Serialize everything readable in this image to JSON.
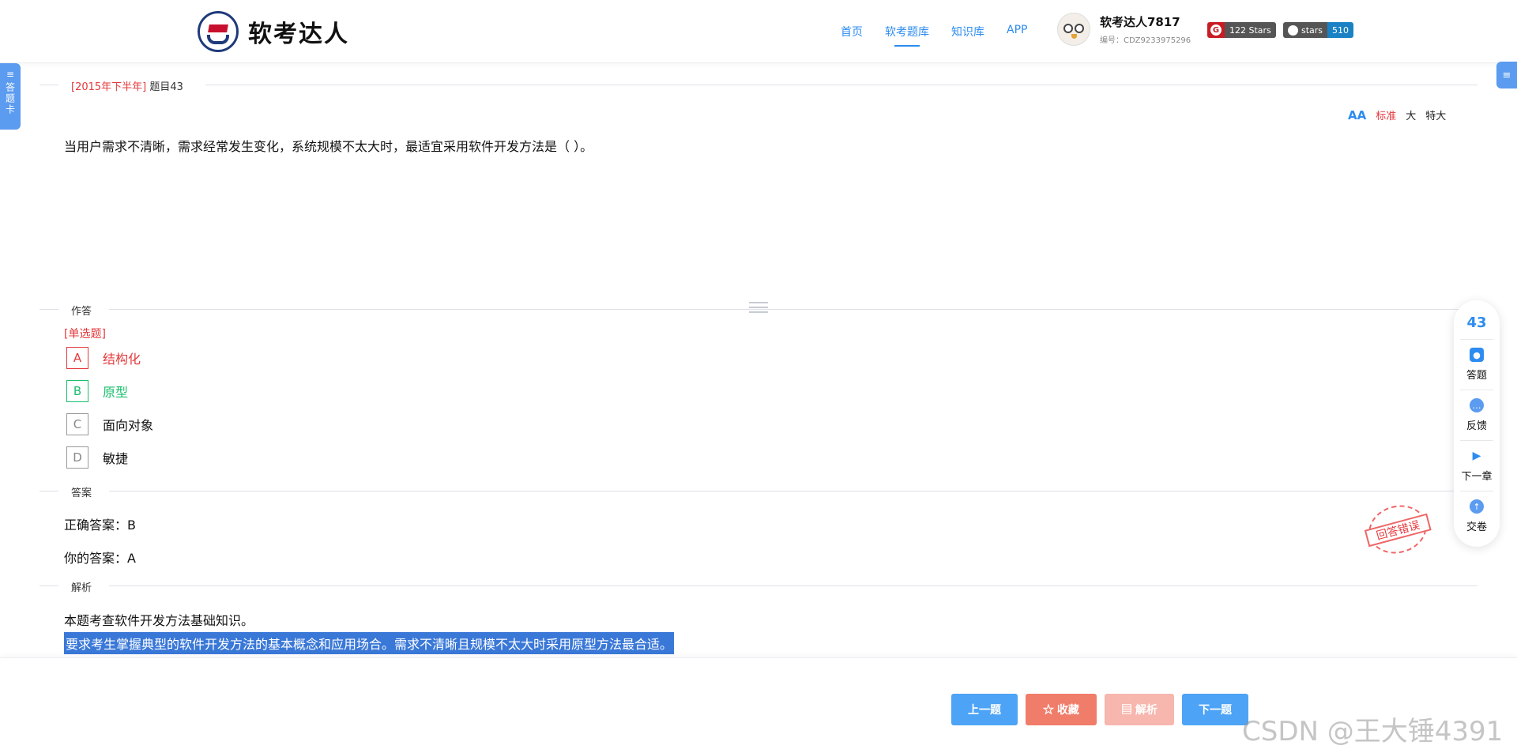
{
  "header": {
    "logo_text": "软考达人",
    "nav": [
      "首页",
      "软考题库",
      "知识库",
      "APP"
    ],
    "active_nav_index": 1,
    "user": {
      "name": "软考达人7817",
      "id_text": "编号：CDZ9233975296"
    },
    "gitee_badge": {
      "icon": "G",
      "label": "122 Stars"
    },
    "github_badge": {
      "label": "stars",
      "count": "510"
    }
  },
  "side": {
    "answer_card_label": "答题卡",
    "menu_icon": "≡"
  },
  "question": {
    "year_tag": "[2015年下半年]",
    "number_label": "题目43",
    "text": "当用户需求不清晰，需求经常发生变化，系统规模不太大时，最适宜采用软件开发方法是（ ）。"
  },
  "font_size": {
    "icon": "AA",
    "options": [
      "标准",
      "大",
      "特大"
    ],
    "active_index": 0
  },
  "sections": {
    "answer_area": "作答",
    "answer": "答案",
    "analysis": "解析"
  },
  "answer_area": {
    "question_type": "[单选题]",
    "options": [
      {
        "key": "A",
        "text": "结构化",
        "state": "wrong"
      },
      {
        "key": "B",
        "text": "原型",
        "state": "correct"
      },
      {
        "key": "C",
        "text": "面向对象",
        "state": "normal"
      },
      {
        "key": "D",
        "text": "敏捷",
        "state": "normal"
      }
    ]
  },
  "answer": {
    "correct": "正确答案：B",
    "yours": "你的答案：A",
    "stamp": "回答错误"
  },
  "analysis": {
    "line1": "本题考查软件开发方法基础知识。",
    "line2": "要求考生掌握典型的软件开发方法的基本概念和应用场合。需求不清晰且规模不太大时采用原型方法最合适。"
  },
  "float_panel": {
    "current_number": "43",
    "items": [
      {
        "label": "答题",
        "icon": "answer-icon"
      },
      {
        "label": "反馈",
        "icon": "feedback-icon"
      },
      {
        "label": "下一章",
        "icon": "next-chapter-icon"
      },
      {
        "label": "交卷",
        "icon": "submit-icon"
      }
    ]
  },
  "footer": {
    "prev": "上一题",
    "favorite": "☆ 收藏",
    "analysis": "▤ 解析",
    "next": "下一题"
  },
  "watermark": "CSDN @王大锤4391",
  "colors": {
    "primary": "#2d8cf0",
    "wrong": "#e4393c",
    "correct": "#19be6b",
    "highlight": "#3a78d8"
  }
}
